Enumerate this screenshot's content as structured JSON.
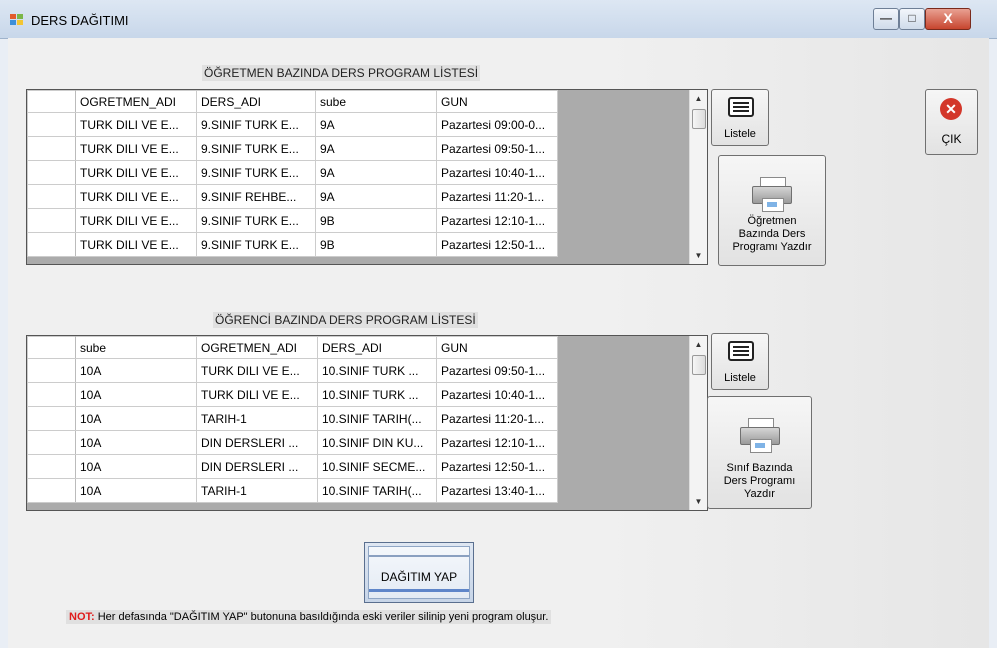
{
  "window": {
    "title": "DERS DAĞITIMI",
    "min_symbol": "—",
    "max_symbol": "□",
    "close_symbol": "X"
  },
  "teacher_section": {
    "caption": "ÖĞRETMEN BAZINDA DERS PROGRAM LİSTESİ",
    "columns": [
      "OGRETMEN_ADI",
      "DERS_ADI",
      "sube",
      "GUN"
    ],
    "rows": [
      [
        "TURK DILI VE E...",
        "9.SINIF TURK E...",
        "9A",
        "Pazartesi 09:00-0..."
      ],
      [
        "TURK DILI VE E...",
        "9.SINIF TURK E...",
        "9A",
        "Pazartesi 09:50-1..."
      ],
      [
        "TURK DILI VE E...",
        "9.SINIF TURK E...",
        "9A",
        "Pazartesi 10:40-1..."
      ],
      [
        "TURK DILI VE E...",
        "9.SINIF REHBE...",
        "9A",
        "Pazartesi 11:20-1..."
      ],
      [
        "TURK DILI VE E...",
        "9.SINIF TURK E...",
        "9B",
        "Pazartesi 12:10-1..."
      ],
      [
        "TURK DILI VE E...",
        "9.SINIF TURK E...",
        "9B",
        "Pazartesi 12:50-1..."
      ]
    ],
    "list_button": "Listele",
    "print_button": [
      "Öğretmen",
      "Bazında Ders",
      "Programı Yazdır"
    ]
  },
  "student_section": {
    "caption": "ÖĞRENCİ BAZINDA DERS PROGRAM LİSTESİ",
    "columns": [
      "sube",
      "OGRETMEN_ADI",
      "DERS_ADI",
      "GUN"
    ],
    "rows": [
      [
        "10A",
        "TURK DILI VE E...",
        "10.SINIF TURK ...",
        "Pazartesi 09:50-1..."
      ],
      [
        "10A",
        "TURK DILI VE E...",
        "10.SINIF TURK ...",
        "Pazartesi 10:40-1..."
      ],
      [
        "10A",
        "TARIH-1",
        "10.SINIF TARIH(...",
        "Pazartesi 11:20-1..."
      ],
      [
        "10A",
        "DIN DERSLERI ...",
        "10.SINIF DIN KU...",
        "Pazartesi 12:10-1..."
      ],
      [
        "10A",
        "DIN DERSLERI ...",
        "10.SINIF SECME...",
        "Pazartesi 12:50-1..."
      ],
      [
        "10A",
        "TARIH-1",
        "10.SINIF TARIH(...",
        "Pazartesi 13:40-1..."
      ]
    ],
    "list_button": "Listele",
    "print_button": [
      "Sınıf Bazında",
      "Ders Programı",
      "Yazdır"
    ]
  },
  "exit_button": "ÇIK",
  "distribute_button": "DAĞITIM YAP",
  "note": {
    "prefix": "NOT:",
    "text": " Her defasında \"DAĞITIM YAP\" butonuna basıldığında eski veriler silinip yeni program oluşur."
  }
}
